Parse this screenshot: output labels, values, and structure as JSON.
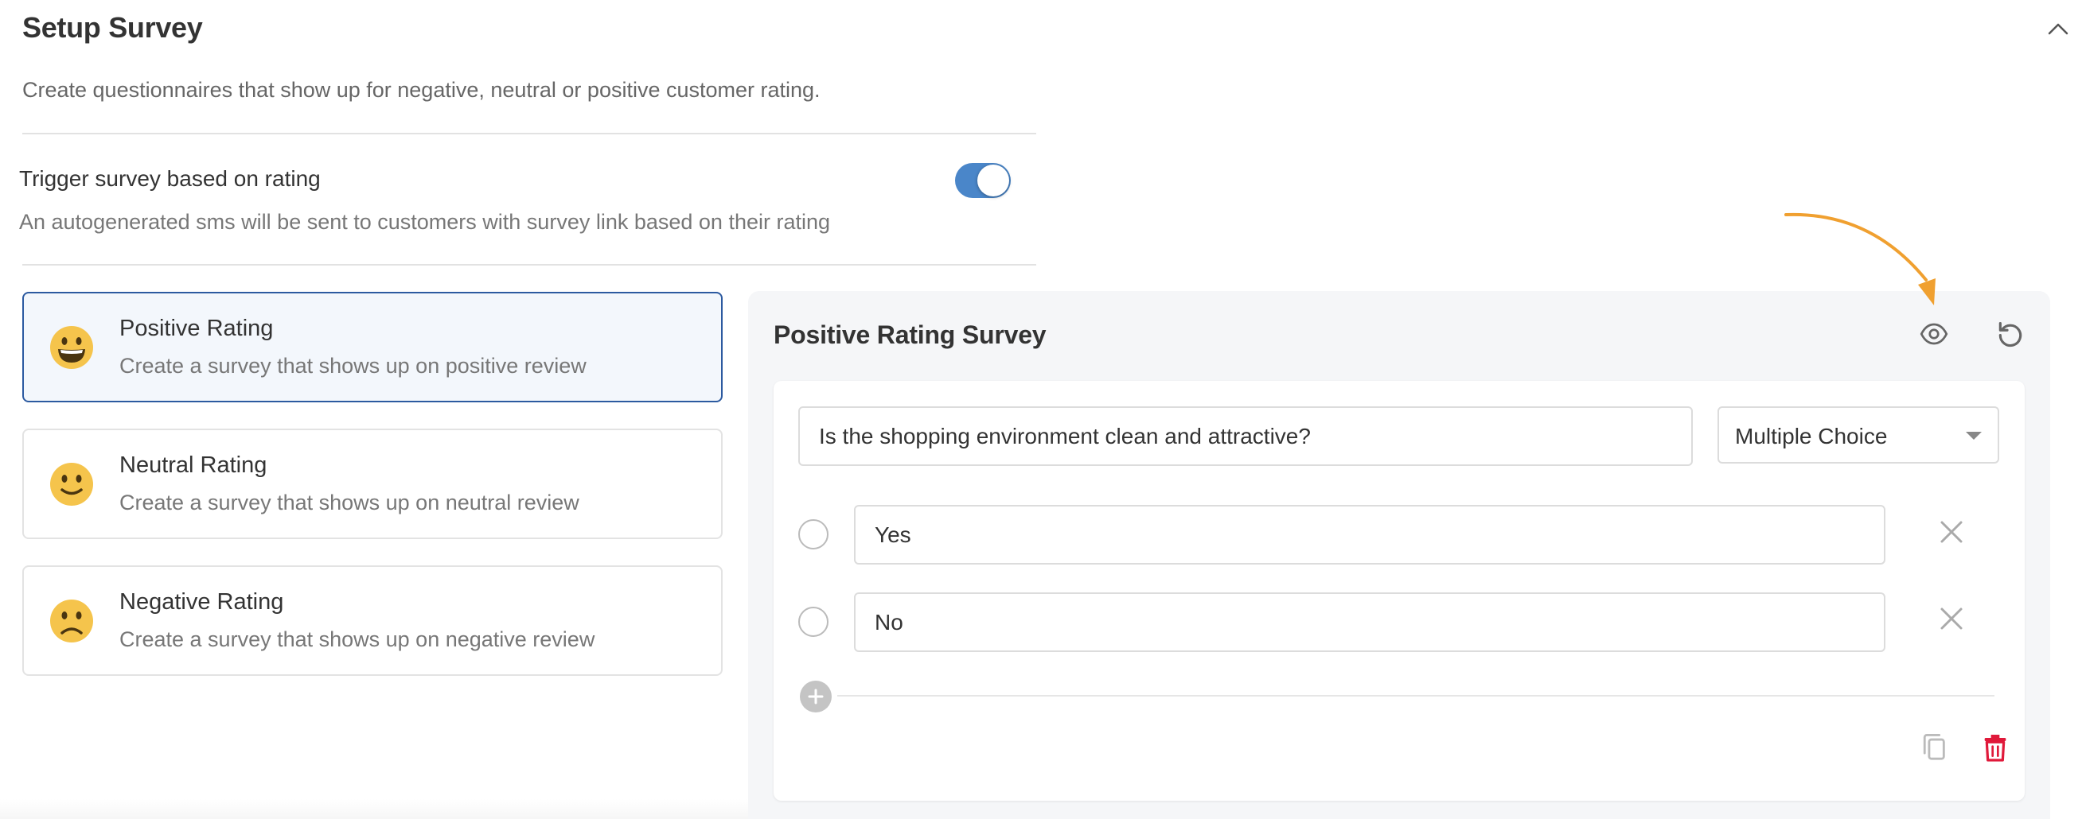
{
  "page": {
    "title": "Setup Survey",
    "description": "Create questionnaires that show up for negative, neutral or positive customer rating."
  },
  "trigger": {
    "title": "Trigger survey based on rating",
    "description": "An autogenerated sms will be sent to customers with survey link based on their rating",
    "enabled": true
  },
  "ratings": [
    {
      "name": "Positive Rating",
      "description": "Create a survey that shows up on positive review",
      "emoji": "grinning-face-icon",
      "selected": true
    },
    {
      "name": "Neutral Rating",
      "description": "Create a survey that shows up on neutral review",
      "emoji": "slightly-smiling-face-icon",
      "selected": false
    },
    {
      "name": "Negative Rating",
      "description": "Create a survey that shows up on negative review",
      "emoji": "frowning-face-icon",
      "selected": false
    }
  ],
  "survey": {
    "title": "Positive Rating Survey",
    "question": "Is the shopping environment clean and attractive?",
    "question_type": "Multiple Choice",
    "options": [
      "Yes",
      "No"
    ]
  },
  "colors": {
    "toggle_on": "#4a86c9",
    "selected_border": "#2c5aa0",
    "delete": "#e0193a",
    "annotation_arrow": "#f0a030",
    "emoji": "#f5c44c"
  }
}
